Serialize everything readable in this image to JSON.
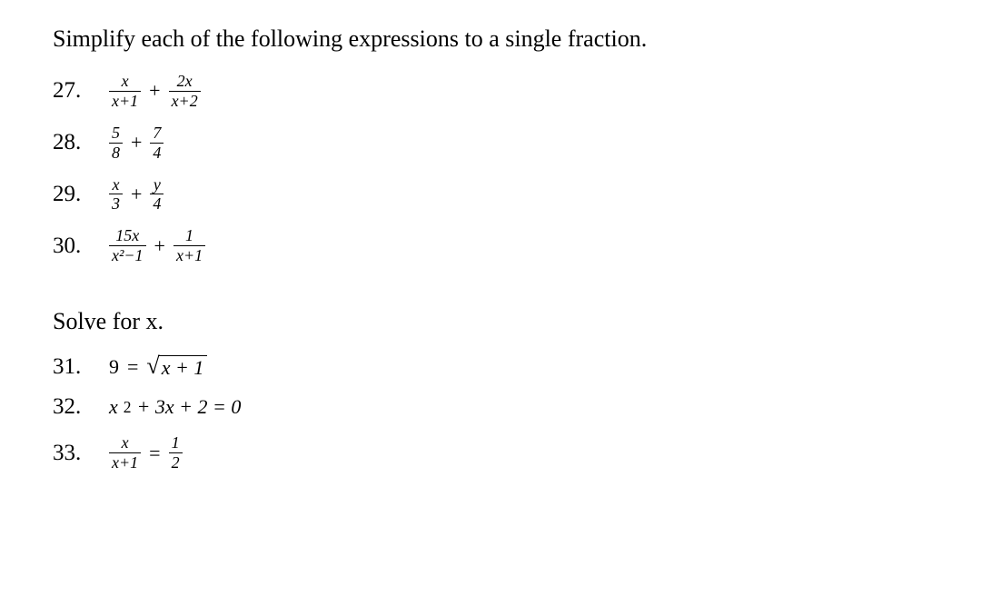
{
  "section1": {
    "instruction": "Simplify each of the following expressions to a single fraction.",
    "problems": [
      {
        "number": "27.",
        "terms": [
          {
            "num": "x",
            "den": "x+1"
          },
          {
            "op": "+"
          },
          {
            "num": "2x",
            "den": "x+2"
          }
        ]
      },
      {
        "number": "28.",
        "terms": [
          {
            "num": "5",
            "den": "8"
          },
          {
            "op": "+"
          },
          {
            "num": "7",
            "den": "4"
          }
        ]
      },
      {
        "number": "29.",
        "terms": [
          {
            "num": "x",
            "den": "3"
          },
          {
            "op": "+"
          },
          {
            "num": "y",
            "den": "4"
          }
        ]
      },
      {
        "number": "30.",
        "terms": [
          {
            "num": "15x",
            "den": "x²−1"
          },
          {
            "op": "+"
          },
          {
            "num": "1",
            "den": "x+1"
          }
        ]
      }
    ]
  },
  "section2": {
    "instruction": "Solve for x.",
    "problems": [
      {
        "number": "31.",
        "lhs": "9",
        "eq": "=",
        "rhs_sqrt": "x + 1"
      },
      {
        "number": "32.",
        "poly": {
          "a": "x",
          "exp": "2",
          "rest": " + 3x + 2 = 0"
        }
      },
      {
        "number": "33.",
        "terms": [
          {
            "num": "x",
            "den": "x+1"
          },
          {
            "op": "="
          },
          {
            "num": "1",
            "den": "2"
          }
        ]
      }
    ]
  }
}
